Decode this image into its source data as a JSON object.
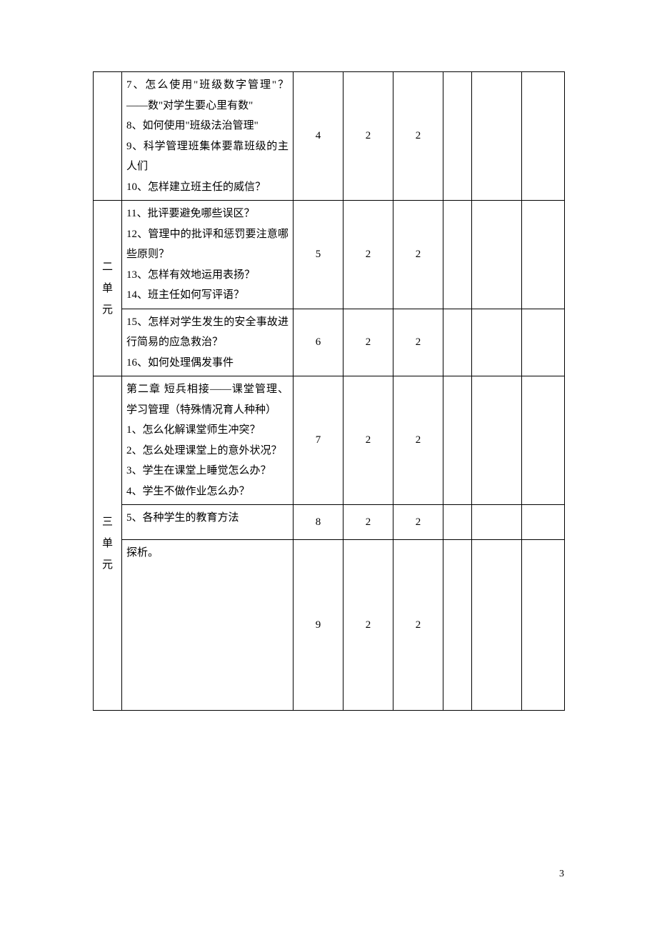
{
  "page_number": "3",
  "units": {
    "u2": "二单元",
    "u3": "三单元"
  },
  "rows": [
    {
      "content": "7、怎么使用\"班级数字管理\"？——数\"对学生要心里有数\"\n8、如何使用\"班级法治管理\"\n9、科学管理班集体要靠班级的主人们\n10、怎样建立班主任的威信？",
      "c1": "4",
      "c2": "2",
      "c3": "2"
    },
    {
      "content": "11、批评要避免哪些误区？\n12、管理中的批评和惩罚要注意哪些原则？\n13、怎样有效地运用表扬？\n14、班主任如何写评语？",
      "c1": "5",
      "c2": "2",
      "c3": "2"
    },
    {
      "content": "15、怎样对学生发生的安全事故进行简易的应急救治？\n16、如何处理偶发事件",
      "c1": "6",
      "c2": "2",
      "c3": "2"
    },
    {
      "content": "第二章 短兵相接——课堂管理、学习管理（特殊情况育人种种）\n1、怎么化解课堂师生冲突？\n2、怎么处理课堂上的意外状况？\n3、学生在课堂上睡觉怎么办？\n4、学生不做作业怎么办？",
      "c1": "7",
      "c2": "2",
      "c3": "2"
    },
    {
      "content": "5、各种学生的教育方法",
      "c1": "8",
      "c2": "2",
      "c3": "2"
    },
    {
      "content": "探析。",
      "c1": "9",
      "c2": "2",
      "c3": "2"
    }
  ]
}
